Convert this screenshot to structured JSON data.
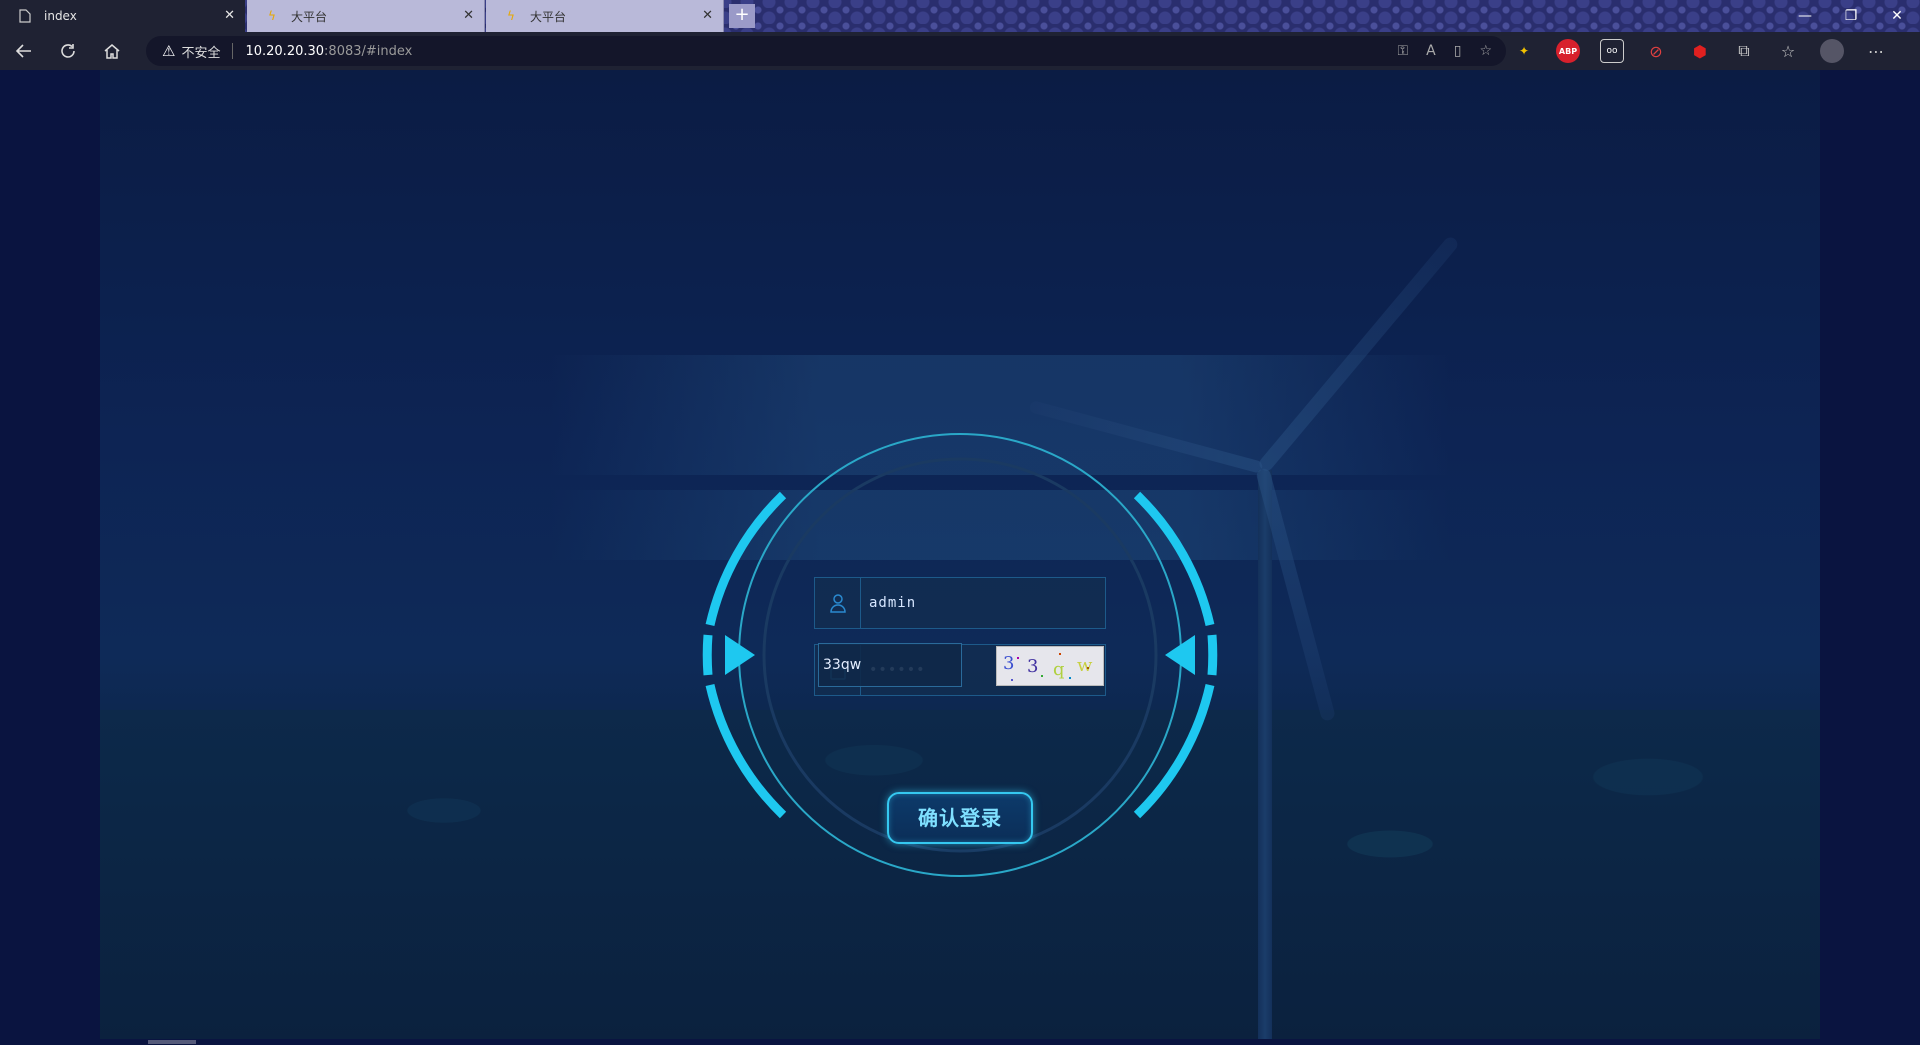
{
  "browser": {
    "tabs": [
      {
        "title": "index",
        "icon": "page-icon"
      },
      {
        "title": "大平台",
        "icon": "lightning-icon"
      },
      {
        "title": "大平台",
        "icon": "lightning-icon"
      }
    ],
    "security_label": "不安全",
    "url_host": "10.20.20.30",
    "url_path": ":8083/#index"
  },
  "login": {
    "username_value": "admin",
    "password_value": "••••••",
    "captcha_value": "33qw",
    "captcha_chars": [
      "3",
      "3",
      "q",
      "w"
    ],
    "submit_label": "确认登录"
  },
  "colors": {
    "accent": "#1ec8f0",
    "page_bg": "#0a1440",
    "ring": "#2aa8c8"
  }
}
